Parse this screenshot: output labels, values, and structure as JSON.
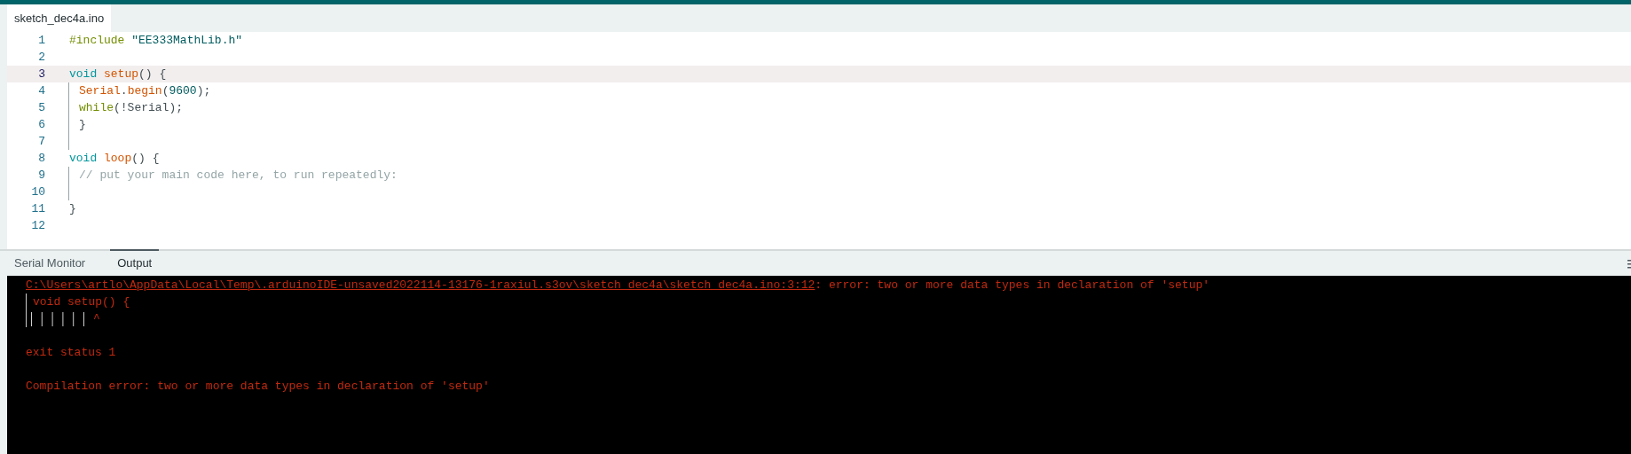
{
  "editor_tabs": [
    {
      "label": "sketch_dec4a.ino",
      "selected": true
    }
  ],
  "code_lines": [
    {
      "number": "1",
      "current": false,
      "guide": false,
      "tokens": [
        {
          "kind": "preprocessor",
          "text": "#include"
        },
        {
          "kind": "string",
          "text": "\"EE333MathLib.h\"",
          "spaced": true
        }
      ]
    },
    {
      "number": "2",
      "current": false,
      "guide": false
    },
    {
      "number": "3",
      "current": true,
      "guide": false,
      "tokens": [
        {
          "kind": "keyword",
          "text": "void"
        },
        {
          "kind": "function",
          "text": "setup",
          "spaced": true
        },
        {
          "kind": "plain",
          "text": "() {"
        }
      ]
    },
    {
      "number": "4",
      "current": false,
      "guide": true,
      "tokens": [
        {
          "kind": "function",
          "text": "Serial"
        },
        {
          "kind": "plain",
          "text": "."
        },
        {
          "kind": "function",
          "text": "begin"
        },
        {
          "kind": "plain",
          "text": "("
        },
        {
          "kind": "string",
          "text": "9600"
        },
        {
          "kind": "plain",
          "text": ");"
        }
      ]
    },
    {
      "number": "5",
      "current": false,
      "guide": true,
      "tokens": [
        {
          "kind": "preprocessor",
          "text": "while"
        },
        {
          "kind": "plain",
          "text": "(!Serial);"
        }
      ]
    },
    {
      "number": "6",
      "current": false,
      "guide": true,
      "tokens": [
        {
          "kind": "plain",
          "text": "}"
        }
      ]
    },
    {
      "number": "7",
      "current": false,
      "guide": true
    },
    {
      "number": "8",
      "current": false,
      "guide": false,
      "tokens": [
        {
          "kind": "keyword",
          "text": "void"
        },
        {
          "kind": "function",
          "text": "loop",
          "spaced": true
        },
        {
          "kind": "plain",
          "text": "() {"
        }
      ]
    },
    {
      "number": "9",
      "current": false,
      "guide": true,
      "tokens": [
        {
          "kind": "comment",
          "text": "// put your main code here, to run repeatedly:"
        }
      ]
    },
    {
      "number": "10",
      "current": false,
      "guide": true
    },
    {
      "number": "11",
      "current": false,
      "guide": false,
      "tokens": [
        {
          "kind": "plain",
          "text": "}"
        }
      ]
    },
    {
      "number": "12",
      "current": false,
      "guide": false
    }
  ],
  "panel_tabs": [
    {
      "label": "Serial Monitor",
      "selected": false
    },
    {
      "label": "Output",
      "selected": true
    }
  ],
  "output_lines": [
    {
      "kind": "location",
      "link": "C:\\Users\\artlo\\AppData\\Local\\Temp\\.arduinoIDE-unsaved2022114-13176-1raxiul.s3ov\\sketch_dec4a\\sketch_dec4a.ino:3:12",
      "text": ": error: two or more data types in declaration of 'setup'"
    },
    {
      "kind": "snippet",
      "text": "void setup() {"
    },
    {
      "kind": "marker",
      "text": "^"
    },
    {
      "kind": "blank"
    },
    {
      "kind": "plain",
      "text": "exit status 1"
    },
    {
      "kind": "blank"
    },
    {
      "kind": "plain",
      "text": "Compilation error: two or more data types in declaration of 'setup'"
    }
  ]
}
